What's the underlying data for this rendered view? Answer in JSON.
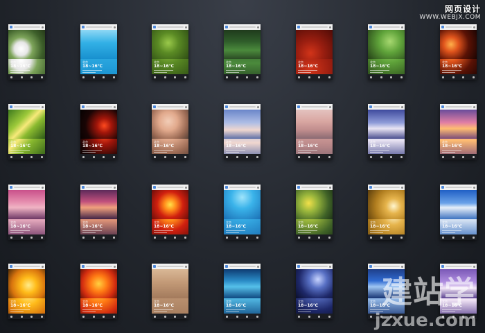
{
  "watermark": {
    "site_cn": "网页设计",
    "site_url": "WWW.WEBJX.COM",
    "logo_cn": "建站学",
    "logo_url": "jzxue.com"
  },
  "tiles": [
    {
      "city": "北京",
      "temp": "18~16℃",
      "bg": "radial-gradient(circle at 35% 65%, #ffffff 0%, #e6e6e6 22%, #7da45a 38%, #3d5f2a 70%, #253818 100%)"
    },
    {
      "city": "北京",
      "temp": "18~16℃",
      "bg": "linear-gradient(180deg, #8fd8f5 0%, #32b0e6 45%, #1890cf 100%)"
    },
    {
      "city": "北京",
      "temp": "18~16℃",
      "bg": "radial-gradient(circle at 45% 45%, #9ac94a 0%, #5a8a24 40%, #2e4d14 100%)"
    },
    {
      "city": "北京",
      "temp": "18~16℃",
      "bg": "linear-gradient(180deg, #1f3a1c 0%, #2f5d2a 40%, #4b8a3c 70%, #2b4c25 100%)"
    },
    {
      "city": "北京",
      "temp": "18~16℃",
      "bg": "radial-gradient(circle at 40% 80%, #d23419 0%, #9a1e10 40%, #4e0b06 100%)"
    },
    {
      "city": "北京",
      "temp": "18~16℃",
      "bg": "radial-gradient(circle at 60% 40%, #a7d870 0%, #5fa33a 40%, #243f16 100%)"
    },
    {
      "city": "北京",
      "temp": "18~16℃",
      "bg": "radial-gradient(circle at 30% 50%, #ffb04a 0%, #e0541c 25%, #5a1205 60%, #1a0402 100%)"
    },
    {
      "city": "北京",
      "temp": "18~16℃",
      "bg": "linear-gradient(135deg, #3d7a1d 0%, #9cc93a 35%, #f7e97a 50%, #8aba2f 65%, #2d5a17 100%)"
    },
    {
      "city": "北京",
      "temp": "18~16℃",
      "bg": "radial-gradient(circle at 65% 55%, #ff4a1f 0%, #a3160a 25%, #1a0505 65%, #050101 100%)"
    },
    {
      "city": "北京",
      "temp": "18~16℃",
      "bg": "radial-gradient(circle at 45% 40%, #f2cdb7 0%, #e1a98c 35%, #9c6b55 70%, #564036 100%)"
    },
    {
      "city": "北京",
      "temp": "18~16℃",
      "bg": "linear-gradient(180deg, #6a86c9 0%, #aebde5 45%, #f0d7cf 70%, #5d6fa7 100%)"
    },
    {
      "city": "北京",
      "temp": "18~16℃",
      "bg": "linear-gradient(180deg, #e4c2bf 0%, #d9a7a2 40%, #c08d8d 70%, #8a6a73 100%)"
    },
    {
      "city": "北京",
      "temp": "18~16℃",
      "bg": "linear-gradient(180deg, #3e4a9d 0%, #8e9bd8 45%, #e9e4f3 65%, #4a4f8f 100%)"
    },
    {
      "city": "北京",
      "temp": "18~16℃",
      "bg": "linear-gradient(180deg, #6a4c9a 0%, #e27fa4 45%, #ffbd72 65%, #7a4b79 100%)"
    },
    {
      "city": "北京",
      "temp": "18~16℃",
      "bg": "linear-gradient(180deg, #c9518b 0%, #e58dae 40%, #f0b3c4 60%, #6c3664 100%)"
    },
    {
      "city": "北京",
      "temp": "18~16℃",
      "bg": "linear-gradient(180deg, #5d2a5a 0%, #c2517d 40%, #f0a07d 60%, #3f2245 100%)"
    },
    {
      "city": "北京",
      "temp": "18~16℃",
      "bg": "radial-gradient(circle at 50% 50%, #ffe24a 0%, #ff8a1a 25%, #d0200f 55%, #6a0d0a 100%)"
    },
    {
      "city": "北京",
      "temp": "18~16℃",
      "bg": "radial-gradient(circle at 50% 25%, #9fe4fb 0%, #3ab3ea 40%, #1b6fb4 100%)"
    },
    {
      "city": "北京",
      "temp": "18~16℃",
      "bg": "radial-gradient(circle at 35% 45%, #f2e04a 0%, #98b53c 30%, #3f6227 70%, #1f3517 100%)"
    },
    {
      "city": "北京",
      "temp": "18~16℃",
      "bg": "radial-gradient(circle at 70% 55%, #fff6cf 0%, #e6b44c 25%, #b07d1f 60%, #5a3d0c 100%)"
    },
    {
      "city": "北京",
      "temp": "18~16℃",
      "bg": "linear-gradient(180deg, #2060c5 0%, #6aa2e8 45%, #e6eef8 60%, #3c72c0 100%)"
    },
    {
      "city": "北京",
      "temp": "18~16℃",
      "bg": "radial-gradient(circle at 55% 55%, #ffeb8a 0%, #ffbb1a 30%, #d8740e 65%, #4a2a08 100%)"
    },
    {
      "city": "北京",
      "temp": "18~16℃",
      "bg": "radial-gradient(circle at 50% 50%, #ffd040 0%, #ff7a14 35%, #d32d10 70%, #6a1208 100%)"
    },
    {
      "city": "北京",
      "temp": "18~16℃",
      "bg": "linear-gradient(180deg, #d9b896 0%, #c39a77 45%, #a37a5c 100%)"
    },
    {
      "city": "北京",
      "temp": "18~16℃",
      "bg": "linear-gradient(180deg, #0e3c72 0%, #2a8bc6 40%, #56c0ea 60%, #0f4880 100%)"
    },
    {
      "city": "北京",
      "temp": "18~16℃",
      "bg": "radial-gradient(circle at 60% 35%, #c8d4ff 0%, #5870c4 30%, #1e2869 65%, #0a0e2a 100%)"
    },
    {
      "city": "北京",
      "temp": "18~16℃",
      "bg": "linear-gradient(180deg, #1e3f8a 0%, #2f6ad0 40%, #9fc6f3 60%, #173473 100%)"
    },
    {
      "city": "北京",
      "temp": "18~16℃",
      "bg": "linear-gradient(180deg, #7a58b6 0%, #b08ee0 45%, #f2e6f6 65%, #5a3f8f 100%)"
    }
  ]
}
